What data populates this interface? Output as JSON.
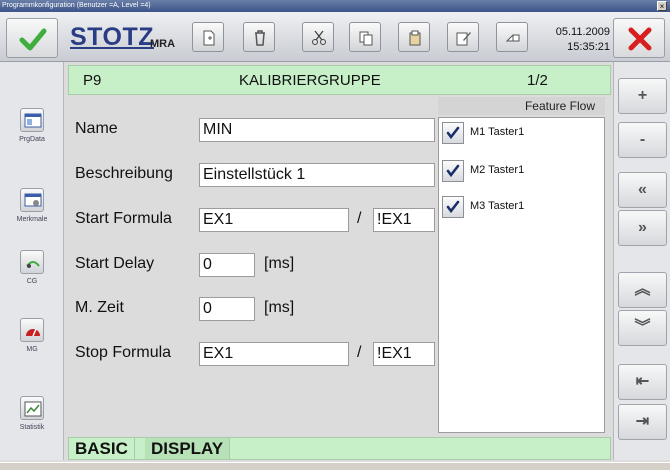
{
  "window": {
    "title": "Programmkonfiguration (Benutzer =A, Level =4)",
    "close_glyph": "×"
  },
  "toolbar": {
    "logo": "STOTZ",
    "product": "MRA",
    "date": "05.11.2009",
    "time": "15:35:21",
    "buttons": [
      "new-document-icon",
      "delete-icon",
      "cut-icon",
      "copy-icon",
      "paste-icon",
      "edit-icon",
      "eraser-icon"
    ]
  },
  "sidebar": {
    "items": [
      {
        "label": "PrgData",
        "icon": "program-data-icon"
      },
      {
        "label": "Merkmale",
        "icon": "features-icon"
      },
      {
        "label": "CG",
        "icon": "cg-icon"
      },
      {
        "label": "MG",
        "icon": "mg-icon"
      },
      {
        "label": "Statistik",
        "icon": "statistics-icon"
      }
    ]
  },
  "header": {
    "code": "P9",
    "title": "KALIBRIERGRUPPE",
    "page": "1/2"
  },
  "form": {
    "name_label": "Name",
    "name_value": "MIN",
    "description_label": "Beschreibung",
    "description_value": "Einstellstück 1",
    "start_formula_label": "Start Formula",
    "start_formula_value": "EX1",
    "start_formula_neg": "!EX1",
    "start_delay_label": "Start Delay",
    "start_delay_value": "0",
    "start_delay_unit": "[ms]",
    "mzeit_label": "M. Zeit",
    "mzeit_value": "0",
    "mzeit_unit": "[ms]",
    "stop_formula_label": "Stop Formula",
    "stop_formula_value": "EX1",
    "stop_formula_neg": "!EX1",
    "slash": "/"
  },
  "feature_flow": {
    "header": "Feature  Flow",
    "items": [
      {
        "label": "M1 Taster1",
        "checked": true
      },
      {
        "label": "M2 Taster1",
        "checked": true
      },
      {
        "label": "M3 Taster1",
        "checked": true
      }
    ]
  },
  "nav": {
    "plus": "+",
    "minus": "-",
    "prev": "«",
    "next": "»",
    "up": "︽",
    "down": "︾",
    "first": "⇤",
    "last": "⇥"
  },
  "tabs": [
    {
      "label": "BASIC",
      "active": true
    },
    {
      "label": "DISPLAY",
      "active": false
    }
  ],
  "colors": {
    "header_green": "#c8f0c8",
    "logo_blue": "#2a3c84",
    "cancel_red": "#d81e1e",
    "ok_green": "#3fae3f"
  }
}
